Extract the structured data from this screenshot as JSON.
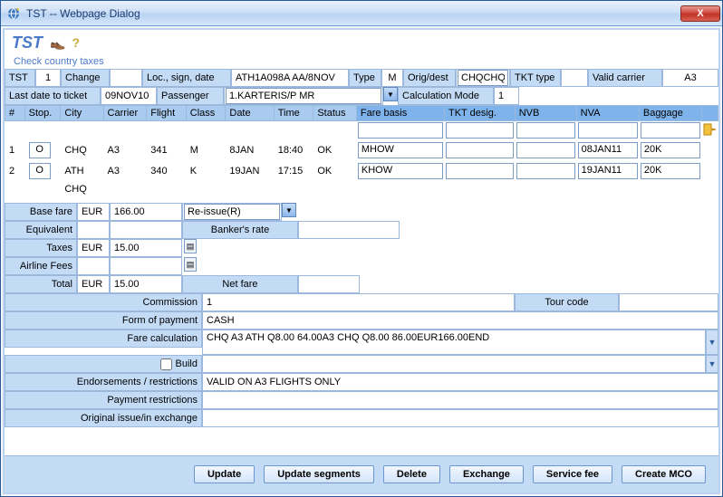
{
  "window": {
    "title": "TST -- Webpage Dialog",
    "close_glyph": "X"
  },
  "header": {
    "logo": "TST",
    "shoe_icon": "👞",
    "help_icon": "?",
    "check_taxes": "Check country taxes"
  },
  "info1": {
    "tst_lbl": "TST",
    "tst_no": "1",
    "change_lbl": "Change",
    "change_val": "",
    "locsign_lbl": "Loc., sign, date",
    "locsign_val": "ATH1A098A AA/8NOV",
    "type_lbl": "Type",
    "type_val": "M",
    "origdest_lbl": "Orig/dest",
    "origdest_val": "CHQCHQ",
    "tkttype_lbl": "TKT type",
    "tkttype_val": "",
    "validcarrier_lbl": "Valid carrier",
    "validcarrier_val": "A3"
  },
  "info2": {
    "lastdate_lbl": "Last date to ticket",
    "lastdate_val": "09NOV10",
    "pax_lbl": "Passenger",
    "pax_val": "1.KARTERIS/P MR",
    "calc_lbl": "Calculation Mode",
    "calc_val": "1"
  },
  "seg_headers": [
    "#",
    "Stop.",
    "City",
    "Carrier",
    "Flight",
    "Class",
    "Date",
    "Time",
    "Status",
    "Fare basis",
    "TKT desig.",
    "NVB",
    "NVA",
    "Baggage"
  ],
  "segs": [
    {
      "n": "1",
      "stop": "O",
      "city": "CHQ",
      "carrier": "A3",
      "flight": "341",
      "cls": "M",
      "date": "8JAN",
      "time": "18:40",
      "status": "OK",
      "farebasis": "MHOW",
      "tktdesig": "",
      "nvb": "",
      "nva": "08JAN11",
      "bag": "20K"
    },
    {
      "n": "2",
      "stop": "O",
      "city": "ATH",
      "carrier": "A3",
      "flight": "340",
      "cls": "K",
      "date": "19JAN",
      "time": "17:15",
      "status": "OK",
      "farebasis": "KHOW",
      "tktdesig": "",
      "nvb": "",
      "nva": "19JAN11",
      "bag": "20K"
    }
  ],
  "seg_last_city": "CHQ",
  "fares": {
    "base_lbl": "Base fare",
    "base_cur": "EUR",
    "base_amt": "166.00",
    "reissue": "Re-issue(R)",
    "equiv_lbl": "Equivalent",
    "equiv_cur": "",
    "equiv_amt": "",
    "bankers": "Banker's rate",
    "bankers_val": "",
    "taxes_lbl": "Taxes",
    "taxes_cur": "EUR",
    "taxes_amt": "15.00",
    "airfee_lbl": "Airline Fees",
    "airfee_cur": "",
    "airfee_amt": "",
    "total_lbl": "Total",
    "total_cur": "EUR",
    "total_amt": "15.00",
    "netfare_lbl": "Net fare",
    "netfare_val": ""
  },
  "lower": {
    "commission_lbl": "Commission",
    "commission_val": "1",
    "tourcode_lbl": "Tour code",
    "tourcode_val": "",
    "fop_lbl": "Form of payment",
    "fop_val": "CASH",
    "farecalc_lbl": "Fare calculation",
    "farecalc_val": "CHQ A3 ATH Q8.00 64.00A3 CHQ Q8.00 86.00EUR166.00END",
    "build_lbl": "Build",
    "endo_lbl": "Endorsements / restrictions",
    "endo_val": "VALID ON A3 FLIGHTS ONLY",
    "payrest_lbl": "Payment restrictions",
    "payrest_val": "",
    "origissue_lbl": "Original issue/in exchange",
    "origissue_val": ""
  },
  "buttons": {
    "update": "Update",
    "update_seg": "Update segments",
    "delete": "Delete",
    "exchange": "Exchange",
    "service_fee": "Service fee",
    "create_mco": "Create MCO"
  }
}
